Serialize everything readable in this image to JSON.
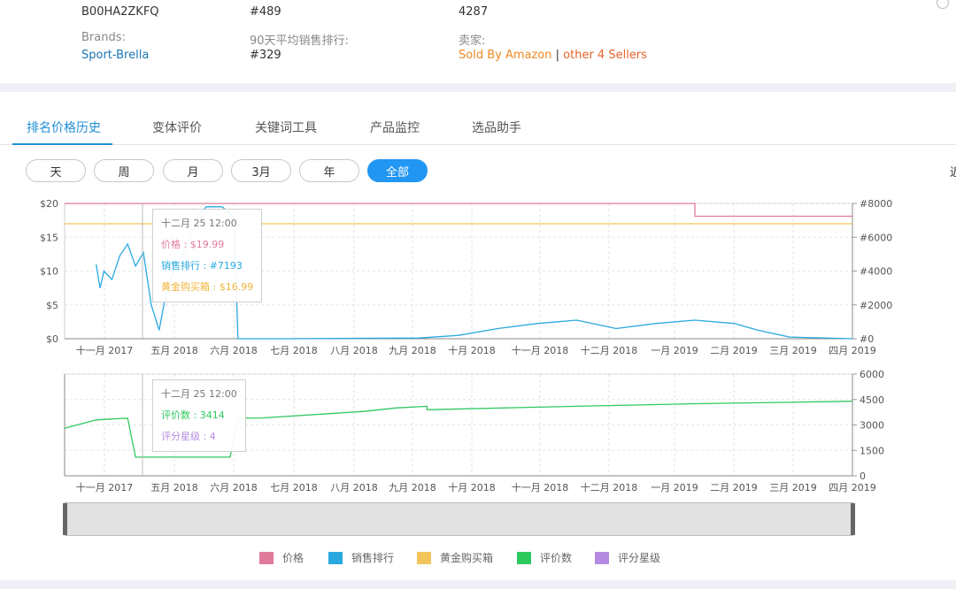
{
  "info": {
    "asin": "B00HA2ZKFQ",
    "rank_current": "#489",
    "reviews_count": "4287",
    "brand_label": "Brands:",
    "brand_value": "Sport-Brella",
    "avg_rank_label": "90天平均销售排行:",
    "avg_rank_value": "#329",
    "seller_label": "卖家:",
    "sold_by": "Sold By Amazon",
    "separator": "|",
    "other_sellers": "other 4 Sellers"
  },
  "tabs": [
    {
      "label": "排名价格历史",
      "active": true
    },
    {
      "label": "变体评价",
      "active": false
    },
    {
      "label": "关键词工具",
      "active": false
    },
    {
      "label": "产品监控",
      "active": false
    },
    {
      "label": "选品助手",
      "active": false
    }
  ],
  "ranges": [
    {
      "label": "天",
      "active": false
    },
    {
      "label": "周",
      "active": false
    },
    {
      "label": "月",
      "active": false
    },
    {
      "label": "3月",
      "active": false
    },
    {
      "label": "年",
      "active": false
    },
    {
      "label": "全部",
      "active": true
    }
  ],
  "edge_glyph": "近",
  "chart_data": [
    {
      "type": "line",
      "x_ticks": [
        "十一月 2017",
        "五月 2018",
        "六月 2018",
        "七月 2018",
        "八月 2018",
        "九月 2018",
        "十月 2018",
        "十一月 2018",
        "十二月 2018",
        "一月 2019",
        "二月 2019",
        "三月 2019",
        "四月 2019"
      ],
      "y_left_ticks": [
        "$0",
        "$5",
        "$10",
        "$15",
        "$20"
      ],
      "y_left_range": [
        0,
        20
      ],
      "y_right_ticks": [
        "#0",
        "#2000",
        "#4000",
        "#6000",
        "#8000"
      ],
      "y_right_range": [
        0,
        8000
      ],
      "grid": true,
      "series": [
        {
          "name": "价格",
          "color": "#e07a9a",
          "axis": "left",
          "points": [
            [
              0.0,
              19.99
            ],
            [
              0.8,
              19.99
            ],
            [
              0.8,
              18.1
            ],
            [
              1.0,
              18.1
            ]
          ]
        },
        {
          "name": "销售排行",
          "color": "#29a9df",
          "axis": "right",
          "points": [
            [
              0.04,
              4400
            ],
            [
              0.045,
              3000
            ],
            [
              0.05,
              4000
            ],
            [
              0.06,
              3500
            ],
            [
              0.07,
              4900
            ],
            [
              0.08,
              5600
            ],
            [
              0.09,
              4300
            ],
            [
              0.1,
              5100
            ],
            [
              0.11,
              2000
            ],
            [
              0.12,
              500
            ],
            [
              0.13,
              3000
            ],
            [
              0.14,
              4200
            ],
            [
              0.15,
              5000
            ],
            [
              0.16,
              6000
            ],
            [
              0.17,
              7300
            ],
            [
              0.18,
              7800
            ],
            [
              0.2,
              7800
            ],
            [
              0.215,
              7193
            ],
            [
              0.22,
              0
            ],
            [
              0.28,
              0
            ],
            [
              0.45,
              40
            ],
            [
              0.5,
              200
            ],
            [
              0.55,
              600
            ],
            [
              0.6,
              900
            ],
            [
              0.65,
              1100
            ],
            [
              0.7,
              600
            ],
            [
              0.75,
              900
            ],
            [
              0.8,
              1100
            ],
            [
              0.85,
              900
            ],
            [
              0.88,
              500
            ],
            [
              0.92,
              100
            ],
            [
              1.0,
              0
            ]
          ]
        },
        {
          "name": "黄金购买箱",
          "color": "#f2c45a",
          "axis": "left",
          "points": [
            [
              0.0,
              16.99
            ],
            [
              1.0,
              16.99
            ]
          ]
        }
      ],
      "tooltip": {
        "time": "十二月 25 12:00",
        "price": "价格 : $19.99",
        "rank": "销售排行 : #7193",
        "buybox": "黄金购买箱 : $16.99"
      }
    },
    {
      "type": "line",
      "x_ticks": [
        "十一月 2017",
        "五月 2018",
        "六月 2018",
        "七月 2018",
        "八月 2018",
        "九月 2018",
        "十月 2018",
        "十一月 2018",
        "十二月 2018",
        "一月 2019",
        "二月 2019",
        "三月 2019",
        "四月 2019"
      ],
      "y_right_ticks": [
        "0",
        "1500",
        "3000",
        "4500",
        "6000"
      ],
      "y_right_range": [
        0,
        6000
      ],
      "grid": true,
      "series": [
        {
          "name": "评价数",
          "color": "#2ec95e",
          "axis": "right",
          "points": [
            [
              0.0,
              2800
            ],
            [
              0.04,
              3300
            ],
            [
              0.08,
              3400
            ],
            [
              0.09,
              1100
            ],
            [
              0.21,
              1100
            ],
            [
              0.22,
              3400
            ],
            [
              0.25,
              3414
            ],
            [
              0.38,
              3800
            ],
            [
              0.42,
              4000
            ],
            [
              0.46,
              4100
            ],
            [
              0.46,
              3900
            ],
            [
              0.6,
              4050
            ],
            [
              0.8,
              4250
            ],
            [
              1.0,
              4400
            ]
          ]
        },
        {
          "name": "评分星级",
          "color": "#b48be0",
          "axis": "right",
          "points": []
        }
      ],
      "tooltip": {
        "time": "十二月 25 12:00",
        "reviews": "评价数 : 3414",
        "rating": "评分星级 : 4"
      }
    }
  ],
  "legend": [
    {
      "name": "价格",
      "color": "#e07a9a"
    },
    {
      "name": "销售排行",
      "color": "#29a9df"
    },
    {
      "name": "黄金购买箱",
      "color": "#f2c45a"
    },
    {
      "name": "评价数",
      "color": "#2ec95e"
    },
    {
      "name": "评分星级",
      "color": "#b48be0"
    }
  ]
}
